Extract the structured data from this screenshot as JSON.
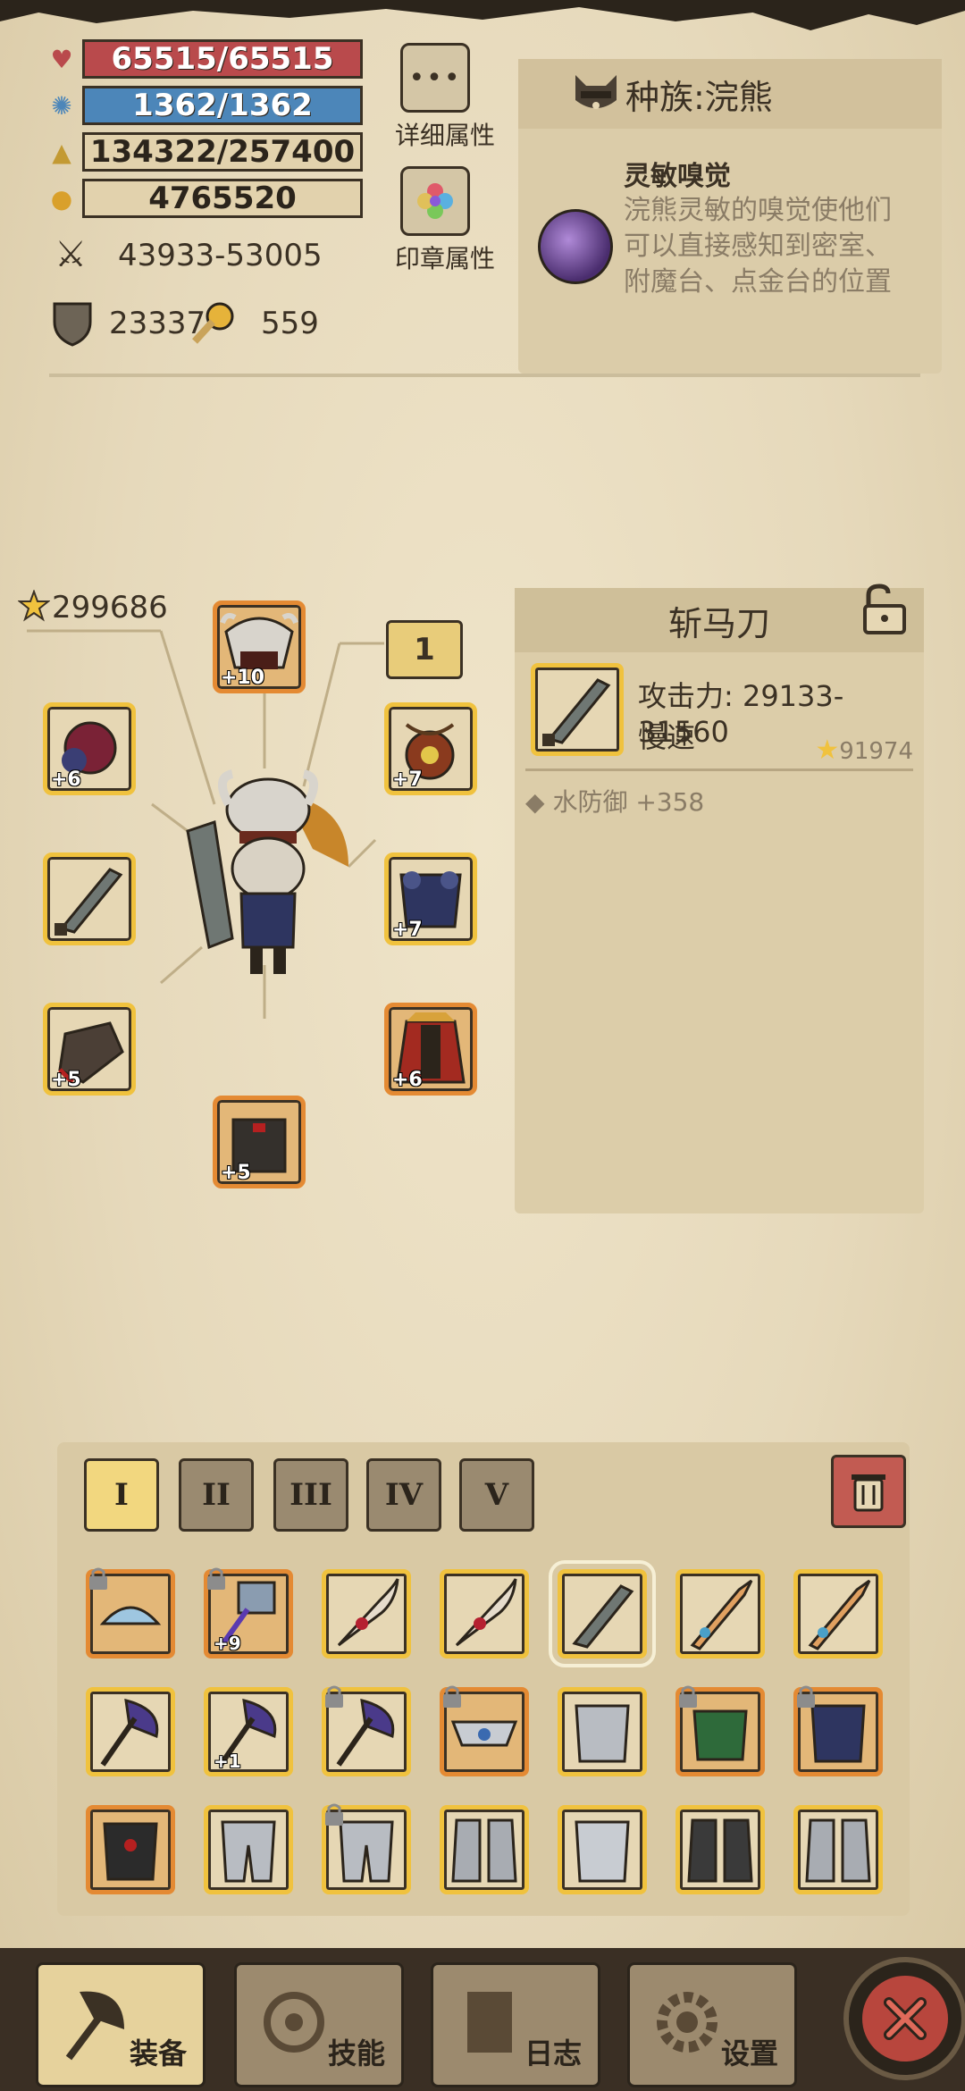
{
  "stats": {
    "hp": "65515/65515",
    "mp": "1362/1362",
    "xp": "134322/257400",
    "gold": "4765520",
    "attack": "43933-53005",
    "defense": "23337",
    "speed": "559"
  },
  "buttons": {
    "detail": "详细属性",
    "seal": "印章属性"
  },
  "race": {
    "title": "种族:浣熊",
    "perk_name": "灵敏嗅觉",
    "perk_desc": "浣熊灵敏的嗅觉使他们可以直接感知到密室、附魔台、点金台的位置"
  },
  "equipment": {
    "total_score": "299686",
    "set_number": "1",
    "levels": {
      "helmet": "+10",
      "amulet": "+6",
      "necklace": "+7",
      "chest": "+7",
      "gloves": "+5",
      "cape": "+6",
      "boots": "+5"
    }
  },
  "item": {
    "name": "斩马刀",
    "attack": "攻击力: 29133-31560",
    "speed": "慢速",
    "score": "91974",
    "attr": "水防御 +358"
  },
  "inventory": {
    "tabs": [
      "I",
      "II",
      "III",
      "IV",
      "V"
    ],
    "row1_levels": [
      "",
      "+9",
      "",
      "",
      "",
      "",
      ""
    ],
    "row2_levels": [
      "",
      "+1",
      "",
      "",
      "",
      "",
      ""
    ]
  },
  "nav": {
    "equip": "装备",
    "skills": "技能",
    "log": "日志",
    "settings": "设置"
  },
  "colors": {
    "hp_bar": "#b94a4c",
    "mp_bar": "#4c86b9",
    "gold_border": "#f0c23e",
    "orange_border": "#e48a33",
    "close": "#b8463d"
  }
}
